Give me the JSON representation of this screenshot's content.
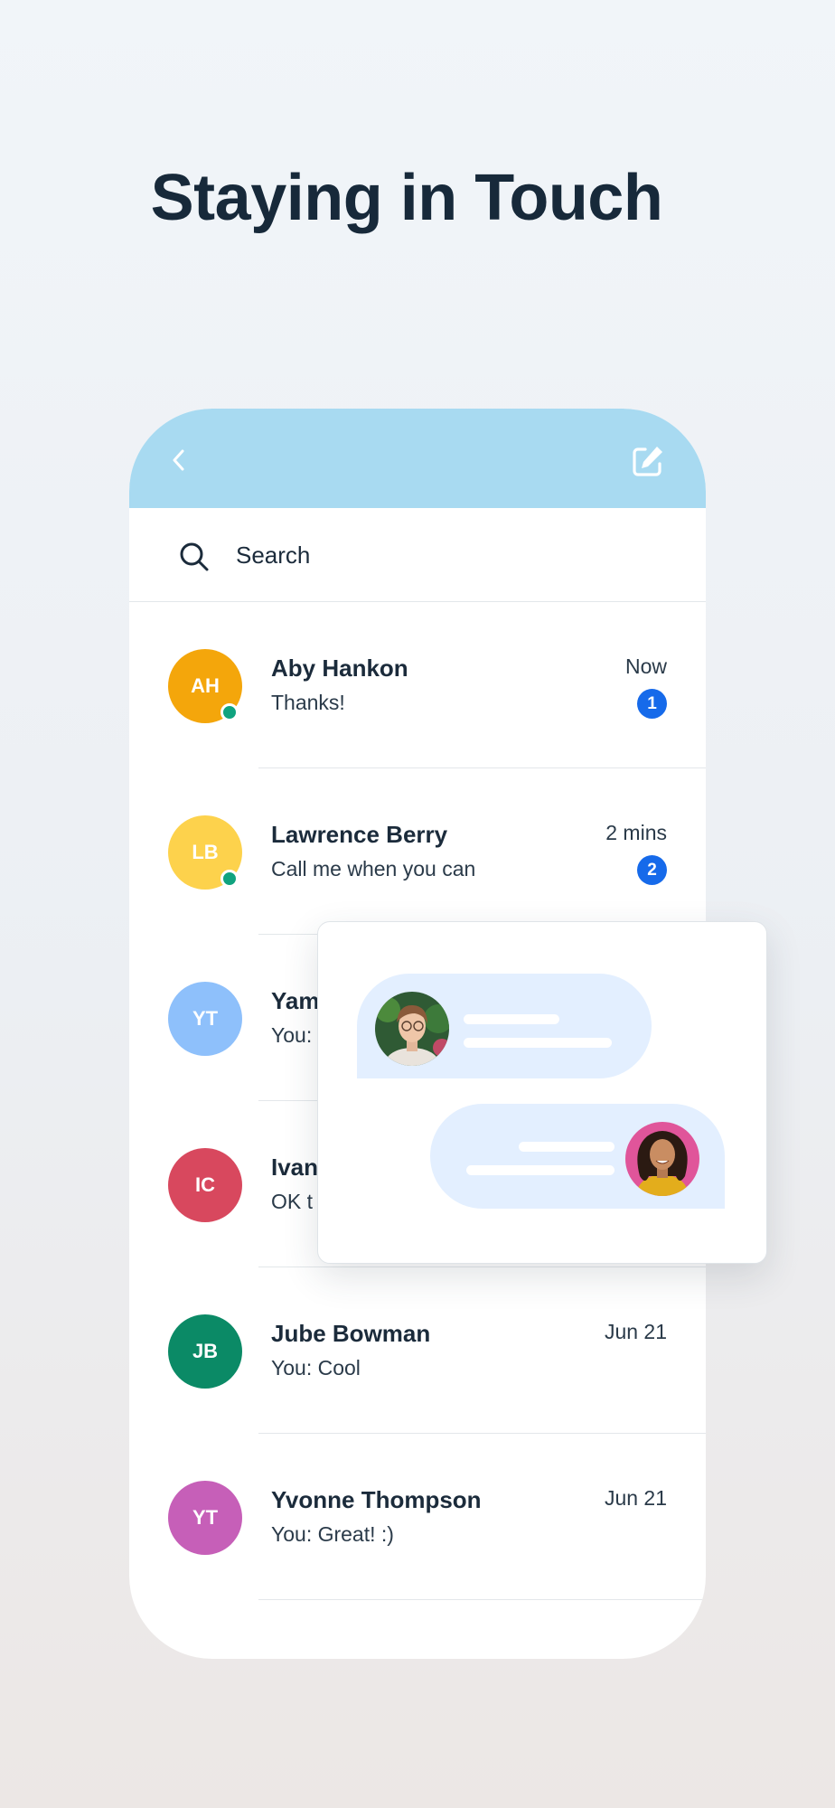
{
  "headline": "Staying in Touch",
  "colors": {
    "header": "#a8daf1",
    "badge": "#166aea",
    "online": "#10a37f",
    "bubble": "#e3efff"
  },
  "icons": {
    "back": "chevron-left-icon",
    "compose": "compose-icon",
    "search": "search-icon"
  },
  "search": {
    "placeholder": "Search"
  },
  "conversations": [
    {
      "initials": "AH",
      "name": "Aby Hankon",
      "preview": "Thanks!",
      "time": "Now",
      "unread": "1",
      "online": true,
      "color": "#f4a60b"
    },
    {
      "initials": "LB",
      "name": "Lawrence Berry",
      "preview": "Call me when you can",
      "time": "2 mins",
      "unread": "2",
      "online": true,
      "color": "#fdd24c"
    },
    {
      "initials": "YT",
      "name": "Yam",
      "preview": "You:",
      "time": "",
      "unread": "",
      "online": false,
      "color": "#8ec0fb"
    },
    {
      "initials": "IC",
      "name": "Ivan",
      "preview": "OK t",
      "time": "",
      "unread": "",
      "online": false,
      "color": "#d8485e"
    },
    {
      "initials": "JB",
      "name": "Jube Bowman",
      "preview": "You: Cool",
      "time": "Jun 21",
      "unread": "",
      "online": false,
      "color": "#0b8a66"
    },
    {
      "initials": "YT",
      "name": "Yvonne Thompson",
      "preview": "You: Great! :)",
      "time": "Jun 21",
      "unread": "",
      "online": false,
      "color": "#c65fb8"
    }
  ]
}
